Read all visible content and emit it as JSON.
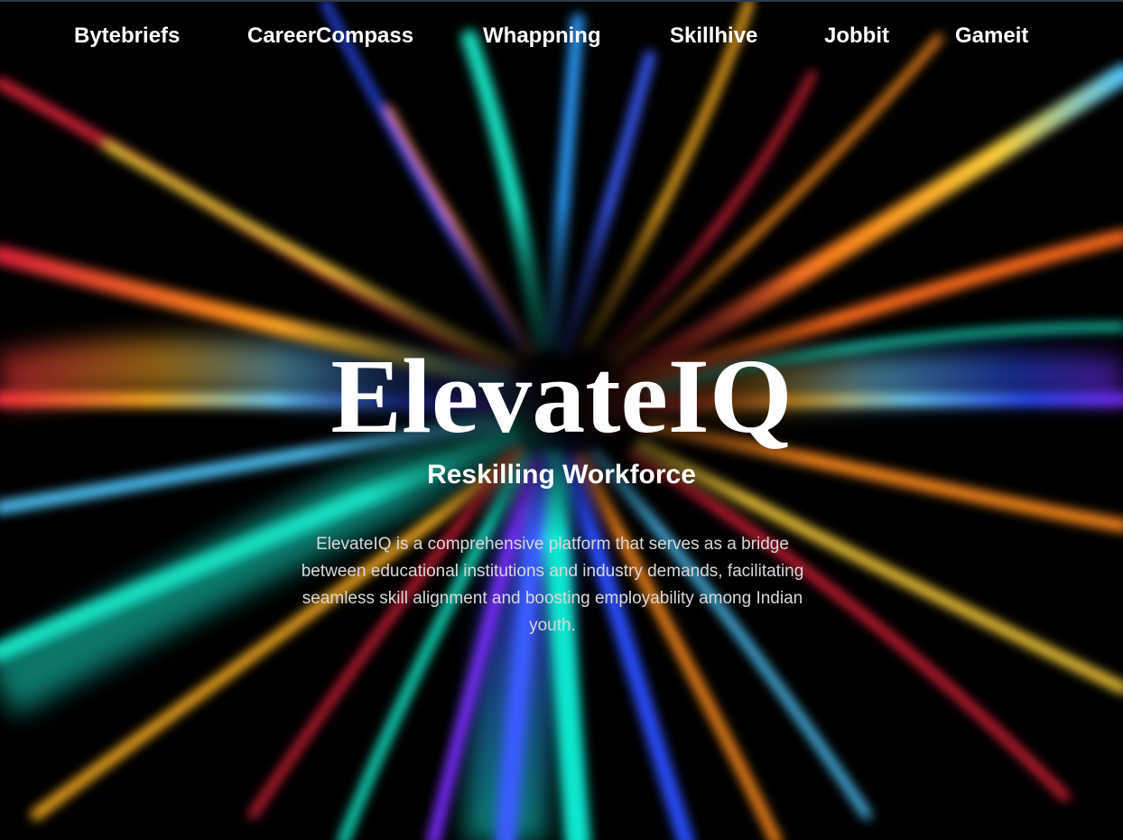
{
  "nav": {
    "items": [
      {
        "label": "Bytebriefs"
      },
      {
        "label": "CareerCompass"
      },
      {
        "label": "Whappning"
      },
      {
        "label": "Skillhive"
      },
      {
        "label": "Jobbit"
      },
      {
        "label": "Gameit"
      }
    ]
  },
  "hero": {
    "title": "ElevateIQ",
    "subtitle": "Reskilling Workforce",
    "description": "ElevateIQ is a comprehensive platform that serves as a bridge between educational institutions and industry demands, facilitating seamless skill alignment and boosting employability among Indian youth."
  },
  "colors": {
    "background": "#000000",
    "text": "#ffffff",
    "description_text": "#d8d8d8",
    "accent_cyan": "#14e0c0",
    "accent_blue": "#2a4dff",
    "accent_orange": "#ff8a1a",
    "accent_red": "#e0203a",
    "accent_yellow": "#ffd23a",
    "accent_purple": "#7a2aff"
  }
}
